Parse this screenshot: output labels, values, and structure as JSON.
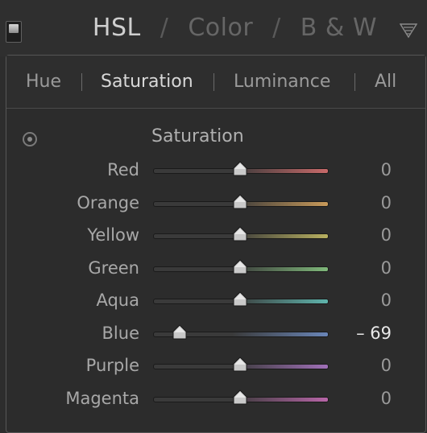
{
  "panel": {
    "title_hsl": "HSL",
    "title_color": "Color",
    "title_bw": "B & W",
    "sep": "/"
  },
  "tabs": [
    {
      "label": "Hue"
    },
    {
      "label": "Saturation",
      "active": true
    },
    {
      "label": "Luminance"
    },
    {
      "label": "All"
    }
  ],
  "section": {
    "title": "Saturation"
  },
  "sliders": [
    {
      "label": "Red",
      "value": "0",
      "level": 0.5,
      "color": "#c86a6a"
    },
    {
      "label": "Orange",
      "value": "0",
      "level": 0.5,
      "color": "#c89a5a"
    },
    {
      "label": "Yellow",
      "value": "0",
      "level": 0.5,
      "color": "#b8b060"
    },
    {
      "label": "Green",
      "value": "0",
      "level": 0.5,
      "color": "#7fb87a"
    },
    {
      "label": "Aqua",
      "value": "0",
      "level": 0.5,
      "color": "#5fb4ac"
    },
    {
      "label": "Blue",
      "value": "– 69",
      "level": 0.155,
      "color": "#6a86b8"
    },
    {
      "label": "Purple",
      "value": "0",
      "level": 0.5,
      "color": "#a070b8"
    },
    {
      "label": "Magenta",
      "value": "0",
      "level": 0.5,
      "color": "#b866a8"
    }
  ],
  "icons": {
    "panel_switch": "switch-icon",
    "collapse": "collapse-triangle-icon",
    "targeted_adjustment": "target-adjust-icon"
  }
}
